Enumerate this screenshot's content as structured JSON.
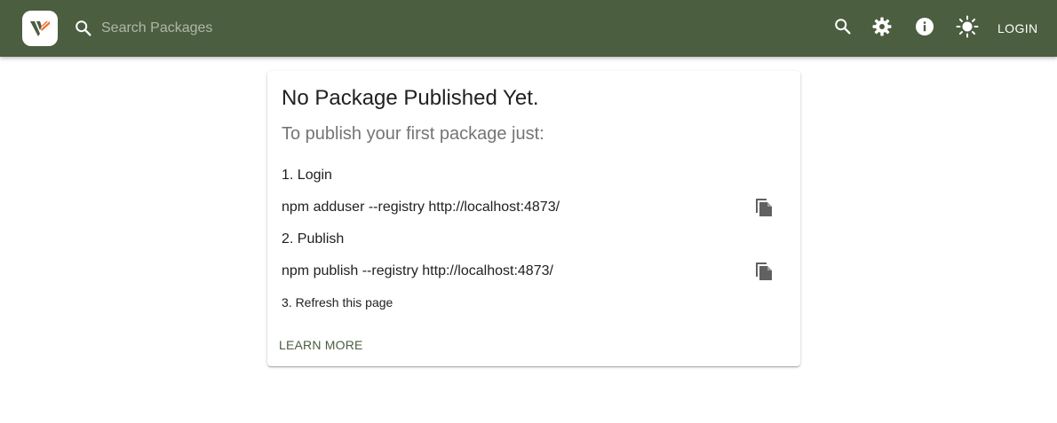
{
  "colors": {
    "appbar": "#4b5e40",
    "accent_logo": "#f26b21",
    "icon_gray": "#616161",
    "subtitle_gray": "#757575"
  },
  "header": {
    "logo_icon": "verdaccio-logo-icon",
    "search": {
      "placeholder": "Search Packages",
      "value": "",
      "icon": "search-icon"
    },
    "actions": [
      {
        "icon": "search-icon"
      },
      {
        "icon": "gear-icon"
      },
      {
        "icon": "info-icon"
      },
      {
        "icon": "sun-icon"
      }
    ],
    "login_label": "LOGIN"
  },
  "card": {
    "title": "No Package Published Yet.",
    "subtitle": "To publish your first package just:",
    "step1": "1. Login",
    "cmd1": "npm adduser --registry http://localhost:4873/",
    "step2": "2. Publish",
    "cmd2": "npm publish --registry http://localhost:4873/",
    "step3": "3. Refresh this page",
    "learn_more": "LEARN MORE",
    "copy_icon": "copy-icon"
  }
}
